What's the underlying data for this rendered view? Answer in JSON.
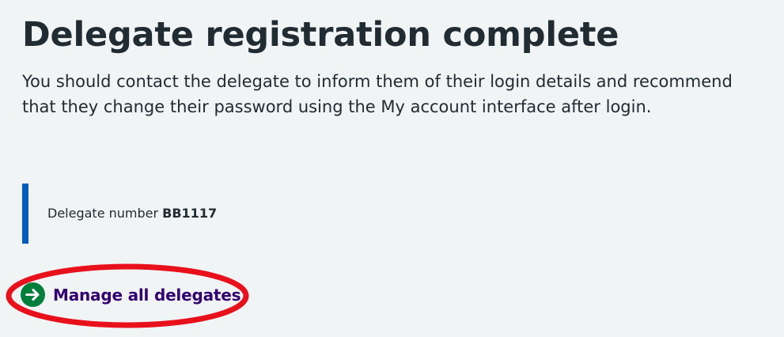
{
  "heading": "Delegate registration complete",
  "body_text": "You should contact the delegate to inform them of their login details and recommend that they change their password using the My account interface after login.",
  "inset": {
    "label": "Delegate number",
    "value": "BB1117"
  },
  "action_link": {
    "label": "Manage all delegates",
    "icon": "arrow-right-circle-icon"
  },
  "annotation": {
    "shape": "ellipse",
    "color": "#e8101b"
  },
  "colors": {
    "background": "#f0f4f5",
    "text": "#212b32",
    "inset_border": "#005eb8",
    "link": "#330072",
    "icon_circle": "#007f3b",
    "annotation": "#e8101b"
  }
}
